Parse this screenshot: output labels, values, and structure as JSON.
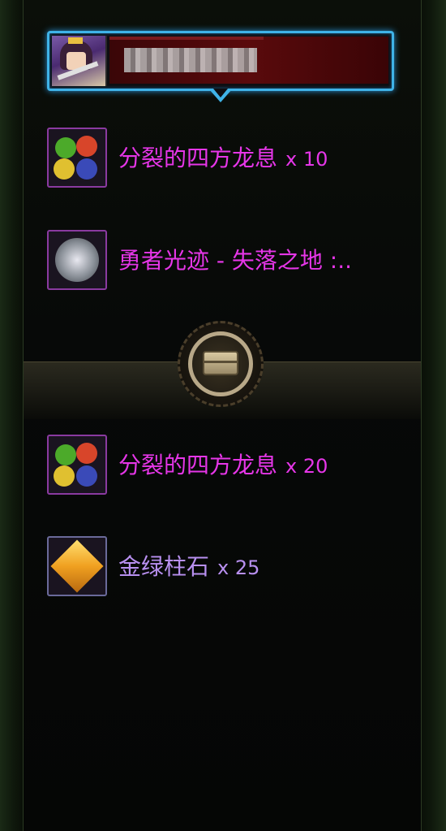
{
  "header": {
    "player_name_obscured": true
  },
  "items_top": [
    {
      "name": "分裂的四方龙息",
      "qty": "x 10",
      "icon": "dragon-breath-gems-icon"
    },
    {
      "name": "勇者光迹 - 失落之地 :..",
      "qty": "",
      "icon": "hero-light-trace-icon"
    }
  ],
  "emblem": {
    "icon": "treasure-chest-emblem-icon"
  },
  "items_bottom": [
    {
      "name": "分裂的四方龙息",
      "qty": "x 20",
      "icon": "dragon-breath-gems-icon"
    },
    {
      "name": "金绿柱石",
      "qty": "x 25",
      "icon": "chrysoberyl-gem-icon"
    }
  ],
  "colors": {
    "rare_text": "#e636e8",
    "epic_text": "#b890f0",
    "header_border": "#3fb3e8",
    "name_bar": "#5a0a0c"
  }
}
